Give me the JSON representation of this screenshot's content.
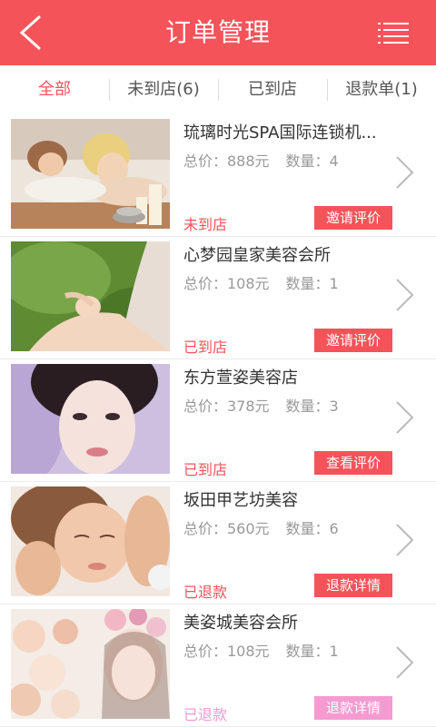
{
  "header": {
    "title": "订单管理",
    "back_icon": "back-arrow-icon",
    "menu_icon": "list-menu-icon"
  },
  "colors": {
    "accent": "#f5535a",
    "pink_button": "#f59bd2"
  },
  "tabs": [
    {
      "label": "全部",
      "active": true
    },
    {
      "label": "未到店(6)",
      "active": false
    },
    {
      "label": "已到店",
      "active": false
    },
    {
      "label": "退款单(1)",
      "active": false
    }
  ],
  "orders": [
    {
      "name": "琉璃时光SPA国际连锁机...",
      "price": "总价：888元",
      "qty": "数量：4",
      "status": "未到店",
      "button": "邀请评价"
    },
    {
      "name": "心梦园皇家美容会所",
      "price": "总价：108元",
      "qty": "数量：1",
      "status": "已到店",
      "button": "邀请评价"
    },
    {
      "name": "东方萱姿美容店",
      "price": "总价：378元",
      "qty": "数量：3",
      "status": "已到店",
      "button": "查看评价"
    },
    {
      "name": "坂田甲艺坊美容",
      "price": "总价：560元",
      "qty": "数量：6",
      "status": "已退款",
      "button": "退款详情"
    },
    {
      "name": "美姿城美容会所",
      "price": "总价：108元",
      "qty": "数量：1",
      "status": "已退款",
      "button": "退款详情"
    }
  ]
}
